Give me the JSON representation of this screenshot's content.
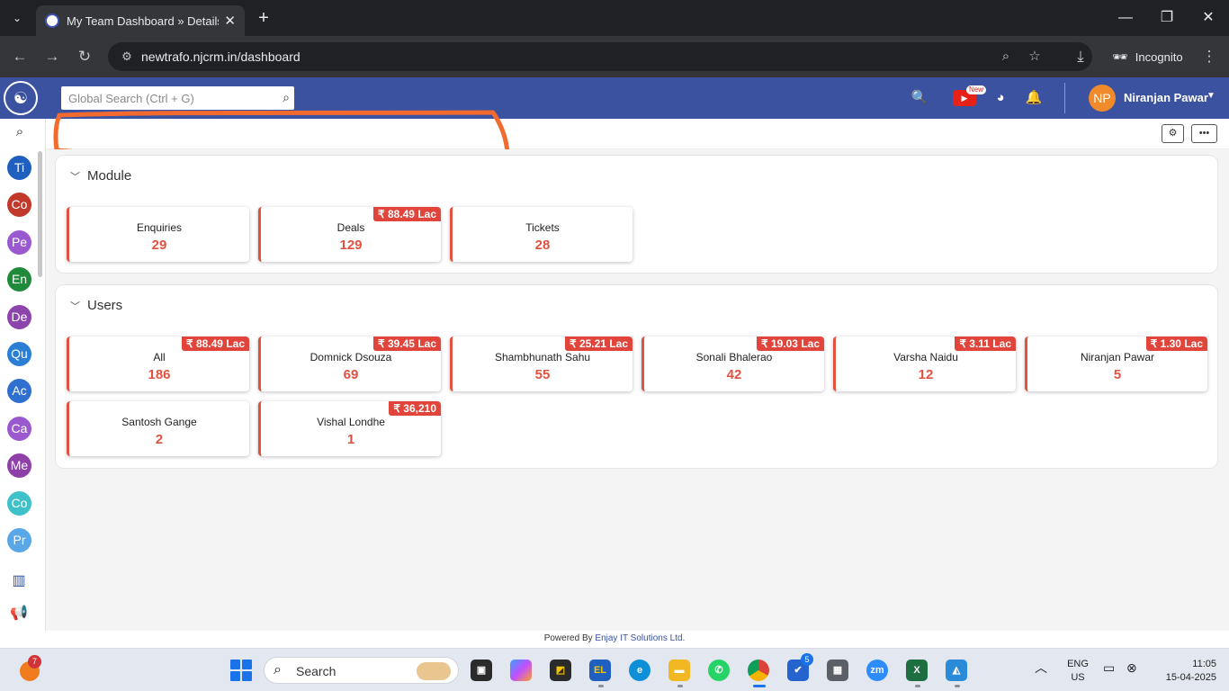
{
  "browser": {
    "tab_title": "My Team Dashboard » Details |",
    "url": "newtrafo.njcrm.in/dashboard",
    "incognito_label": "Incognito"
  },
  "header": {
    "search_placeholder": "Global Search (Ctrl + G)",
    "new_badge": "New",
    "user_initials": "NP",
    "user_name": "Niranjan Pawar"
  },
  "sidebar": {
    "items": [
      {
        "label": "Ti",
        "color": "#1f5fbf"
      },
      {
        "label": "Co",
        "color": "#c0392b"
      },
      {
        "label": "Pe",
        "color": "#9b59d0"
      },
      {
        "label": "En",
        "color": "#1e8a3a"
      },
      {
        "label": "De",
        "color": "#8e44ad"
      },
      {
        "label": "Qu",
        "color": "#2a7fd4"
      },
      {
        "label": "Ac",
        "color": "#2f6fd0"
      },
      {
        "label": "Ca",
        "color": "#9b59d0"
      },
      {
        "label": "Me",
        "color": "#8e3fa8"
      },
      {
        "label": "Co",
        "color": "#3ec1c9"
      },
      {
        "label": "Pr",
        "color": "#5aa7e8"
      }
    ]
  },
  "module_section": {
    "title": "Module",
    "cards": [
      {
        "label": "Enquiries",
        "count": "29",
        "amount": ""
      },
      {
        "label": "Deals",
        "count": "129",
        "amount": "₹ 88.49 Lac"
      },
      {
        "label": "Tickets",
        "count": "28",
        "amount": ""
      }
    ]
  },
  "users_section": {
    "title": "Users",
    "cards": [
      {
        "label": "All",
        "count": "186",
        "amount": "₹ 88.49 Lac"
      },
      {
        "label": "Domnick Dsouza",
        "count": "69",
        "amount": "₹ 39.45 Lac"
      },
      {
        "label": "Shambhunath Sahu",
        "count": "55",
        "amount": "₹ 25.21 Lac"
      },
      {
        "label": "Sonali Bhalerao",
        "count": "42",
        "amount": "₹ 19.03 Lac"
      },
      {
        "label": "Varsha Naidu",
        "count": "12",
        "amount": "₹ 3.11 Lac"
      },
      {
        "label": "Niranjan Pawar",
        "count": "5",
        "amount": "₹ 1.30 Lac"
      },
      {
        "label": "Santosh Gange",
        "count": "2",
        "amount": ""
      },
      {
        "label": "Vishal Londhe",
        "count": "1",
        "amount": "₹ 36,210"
      }
    ]
  },
  "footer": {
    "prefix": "Powered By",
    "company": "Enjay IT Solutions Ltd."
  },
  "taskbar": {
    "weather_badge": "7",
    "search_label": "Search",
    "todo_badge": "5",
    "lang_top": "ENG",
    "lang_bottom": "US",
    "time": "11:05",
    "date": "15-04-2025"
  }
}
